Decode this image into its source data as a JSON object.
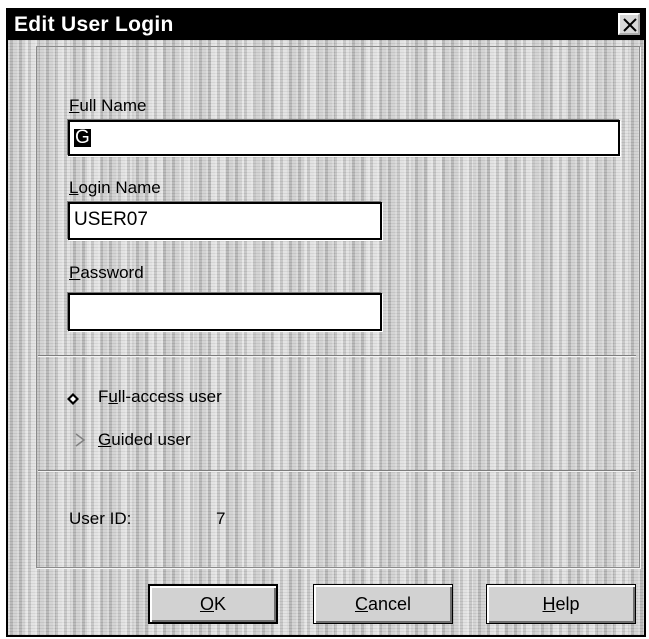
{
  "dialog": {
    "title": "Edit User Login"
  },
  "fields": {
    "full_name": {
      "label_key": "F",
      "label_rest": "ull Name",
      "value": "G"
    },
    "login_name": {
      "label_key": "L",
      "label_rest": "ogin Name",
      "value": "USER07"
    },
    "password": {
      "label_key": "P",
      "label_rest": "assword",
      "value": ""
    }
  },
  "access": {
    "full_access": {
      "label_pre": "F",
      "label_key": "u",
      "label_rest": "ll-access user",
      "selected": true
    },
    "guided": {
      "label_key": "G",
      "label_rest": "uided user",
      "selected": false
    }
  },
  "user_id": {
    "label": "User ID:",
    "value": "7"
  },
  "buttons": {
    "ok": {
      "key": "O",
      "rest": "K"
    },
    "cancel": {
      "key": "C",
      "rest": "ancel"
    },
    "help": {
      "key": "H",
      "rest": "elp"
    }
  },
  "icons": {
    "close": "close-icon",
    "radio_selected": "radio-selected-icon",
    "radio_unselected": "radio-unselected-icon"
  }
}
